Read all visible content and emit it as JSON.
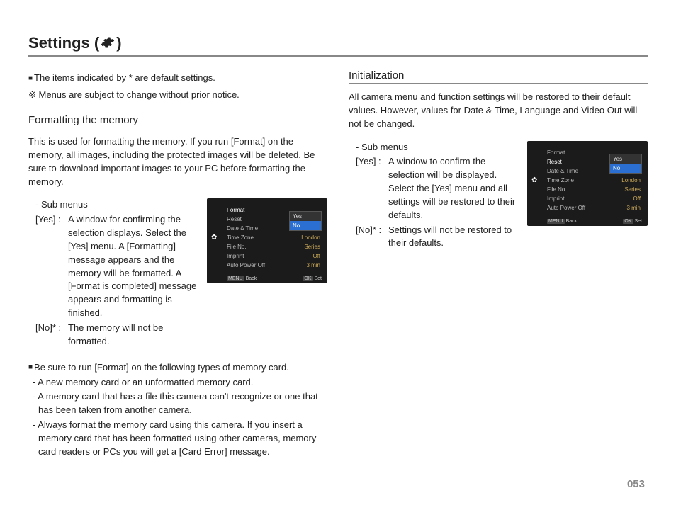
{
  "title_prefix": "Settings (",
  "title_suffix": " )",
  "notes": {
    "n1": "The items indicated by * are default settings.",
    "n2": "Menus are subject to change without prior notice."
  },
  "left": {
    "heading": "Formatting the memory",
    "body": "This is used for formatting the memory. If you run [Format] on the memory, all images, including the protected images will be deleted. Be sure to download important images to your PC before formatting the memory.",
    "sub_label": "- Sub menus",
    "opt_yes_label": "[Yes]  :",
    "opt_yes_desc": "A window for confirming the selection displays. Select the [Yes] menu. A [Formatting] message appears and the memory will be formatted. A [Format is completed] message appears and formatting is finished.",
    "opt_no_label": "[No]*  :",
    "opt_no_desc": "The memory will not be formatted.",
    "bullet_head": "Be sure to run [Format] on the following types of memory card.",
    "b1": "- A new memory card or an unformatted memory card.",
    "b2": "- A memory card that has a file this camera can't recognize or one that has been taken from another camera.",
    "b3": "- Always format the memory card using this camera. If you insert a memory card that has been formatted using other cameras, memory card readers or PCs you will get a [Card Error] message."
  },
  "right": {
    "heading": "Initialization",
    "body": "All camera menu and function settings will be restored to their default values. However, values for Date & Time, Language and Video Out will not be changed.",
    "sub_label": "- Sub menus",
    "opt_yes_label": "[Yes]  :",
    "opt_yes_desc": "A window to confirm the selection will be displayed. Select the [Yes] menu and all settings will be restored to their defaults.",
    "opt_no_label": "[No]* :",
    "opt_no_desc": "Settings will not be restored to their defaults."
  },
  "cam": {
    "menu": [
      "Format",
      "Reset",
      "Date & Time",
      "Time Zone",
      "File No.",
      "Imprint",
      "Auto Power Off"
    ],
    "vals": [
      "London",
      "Series",
      "Off",
      "3 min"
    ],
    "popup_yes": "Yes",
    "popup_no": "No",
    "back": "Back",
    "set": "Set",
    "menu_btn": "MENU",
    "ok_btn": "OK"
  },
  "cam_left_highlight": "Format",
  "cam_right_highlight": "Reset",
  "page_num": "053"
}
